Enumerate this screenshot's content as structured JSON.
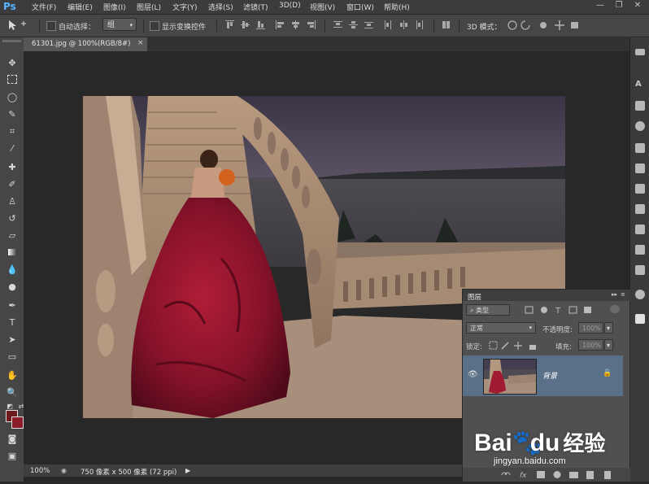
{
  "app": {
    "logo": "Ps"
  },
  "menu": [
    "文件(F)",
    "编辑(E)",
    "图像(I)",
    "图层(L)",
    "文字(Y)",
    "选择(S)",
    "滤镜(T)",
    "3D(D)",
    "视图(V)",
    "窗口(W)",
    "帮助(H)"
  ],
  "window_controls": {
    "minimize": "—",
    "restore": "❐",
    "close": "✕"
  },
  "options_bar": {
    "auto_select_label": "自动选择：",
    "auto_select_value": "组",
    "show_transform_label": "显示变换控件",
    "mode_3d_label": "3D 模式："
  },
  "document": {
    "tab_title": "61301.jpg @ 100%(RGB/8#)",
    "tab_close": "×",
    "zoom": "100%",
    "dimensions": "750 像素 x 500 像素 (72 ppi)"
  },
  "layers_panel": {
    "title": "图层",
    "filter_label": "类型",
    "blend_mode": "正常",
    "opacity_label": "不透明度:",
    "opacity_value": "100%",
    "lock_label": "锁定:",
    "fill_label": "填充:",
    "fill_value": "100%",
    "layers": [
      {
        "name": "背景",
        "visible": true,
        "locked": true,
        "selected": true
      }
    ]
  },
  "colors": {
    "foreground": "#6e1a1f",
    "background": "#8a1d29",
    "selected_layer": "#5a7088",
    "accent": "#5ab4ff"
  },
  "watermark": {
    "brand_a": "Bai",
    "brand_b": "du",
    "brand_cn": "经验",
    "url": "jingyan.baidu.com"
  }
}
